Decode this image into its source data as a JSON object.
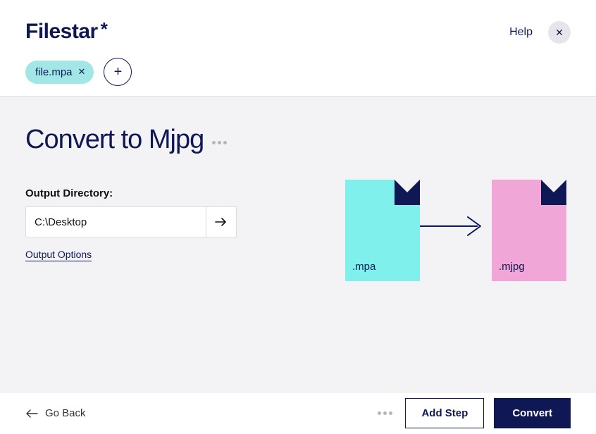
{
  "brand": {
    "name": "Filestar",
    "suffix": "*"
  },
  "header": {
    "help_label": "Help",
    "files": [
      {
        "name": "file.mpa"
      }
    ]
  },
  "main": {
    "title": "Convert to Mjpg",
    "output_directory_label": "Output Directory:",
    "output_directory_value": "C:\\Desktop",
    "output_options_label": "Output Options"
  },
  "conversion": {
    "source_ext": ".mpa",
    "target_ext": ".mjpg"
  },
  "footer": {
    "go_back_label": "Go Back",
    "add_step_label": "Add Step",
    "convert_label": "Convert"
  },
  "colors": {
    "accent": "#0f1855",
    "chip": "#a0e7e5",
    "source_file": "#7ff0ec",
    "target_file": "#f0a6d6"
  }
}
